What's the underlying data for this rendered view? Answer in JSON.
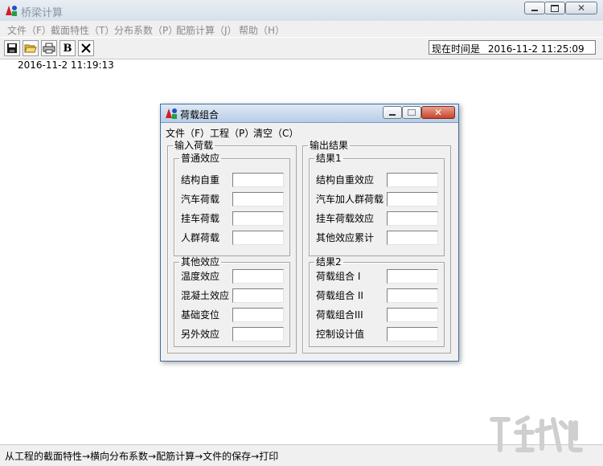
{
  "window": {
    "title": "桥梁计算"
  },
  "menu": [
    {
      "label": "文件（F）"
    },
    {
      "label": "截面特性（T）"
    },
    {
      "label": "分布系数（P）"
    },
    {
      "label": "配筋计算（J）"
    },
    {
      "label": "帮助（H）"
    }
  ],
  "toolbar": {
    "icons": [
      "save-icon",
      "open-icon",
      "print-icon",
      "bold-b-icon",
      "close-x-icon"
    ],
    "bold_label": "B",
    "clock_label": "现在时间是",
    "clock_value": "2016-11-2  11:25:09"
  },
  "main": {
    "start_time": "2016-11-2  11:19:13"
  },
  "status": {
    "text": "从工程的截面特性→横向分布系数→配筋计算→文件的保存→打印"
  },
  "dialog": {
    "title": "荷载组合",
    "menu": [
      "文件（F）",
      "工程（P）",
      "清空（C）"
    ],
    "input_group": {
      "legend": "输入荷载",
      "normal": {
        "legend": "普通效应",
        "labels": [
          "结构自重",
          "汽车荷载",
          "挂车荷载",
          "人群荷载"
        ]
      },
      "other": {
        "legend": "其他效应",
        "labels": [
          "温度效应",
          "混凝土效应",
          "基础变位",
          "另外效应"
        ]
      }
    },
    "output_group": {
      "legend": "输出结果",
      "result1": {
        "legend": "结果1",
        "labels": [
          "结构自重效应",
          "汽车加人群荷载",
          "挂车荷载效应",
          "其他效应累计"
        ]
      },
      "result2": {
        "legend": "结果2",
        "labels": [
          "荷载组合 I",
          "荷载组合 II",
          "荷载组合III",
          "控制设计值"
        ]
      }
    }
  },
  "colors": {
    "dialog_border": "#3b6ea5",
    "titlebar": "#d7e0ea"
  }
}
